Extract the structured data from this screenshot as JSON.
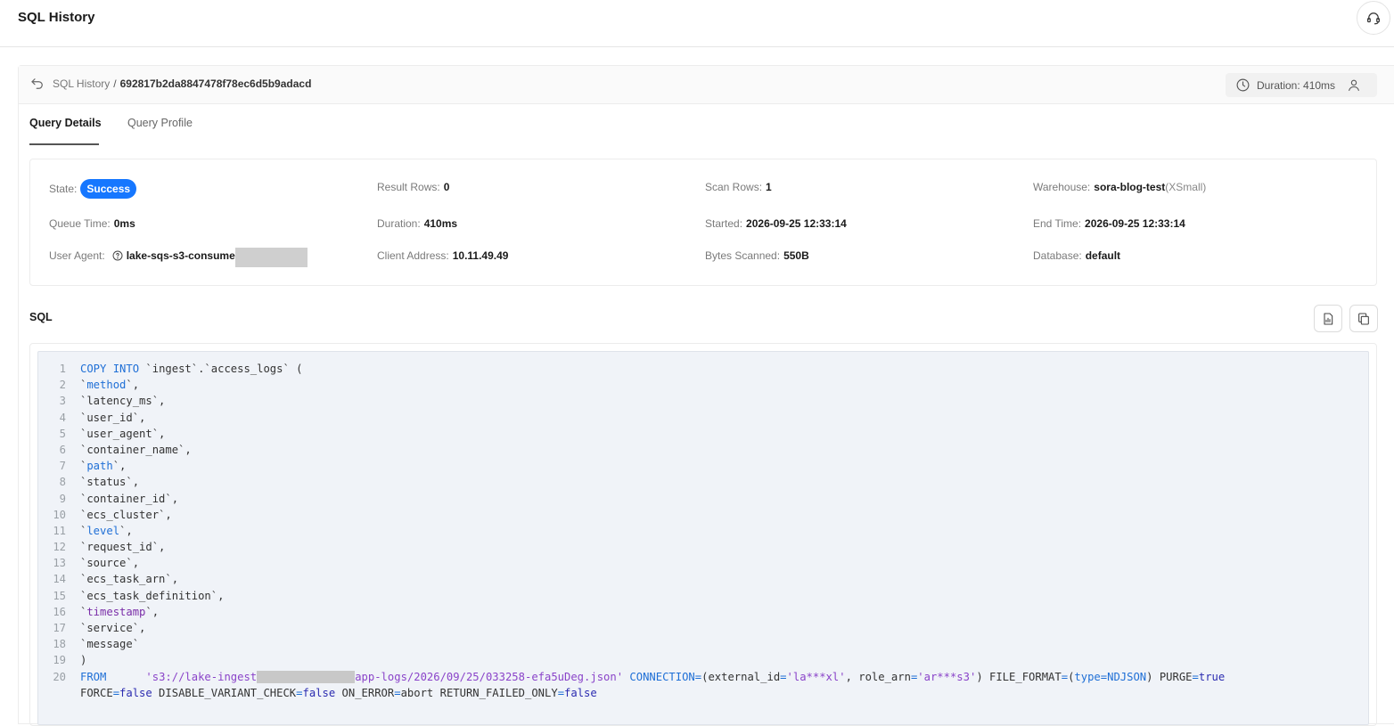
{
  "page": {
    "title": "SQL History"
  },
  "breadcrumb": {
    "parent": "SQL History",
    "separator": "/",
    "current": "692817b2da8847478f78ec6d5b9adacd"
  },
  "duration_pill": {
    "text": "Duration: 410ms"
  },
  "tabs": [
    {
      "label": "Query Details",
      "active": true
    },
    {
      "label": "Query Profile",
      "active": false
    }
  ],
  "details": {
    "state": {
      "label": "State",
      "value": "Success"
    },
    "result_rows": {
      "label": "Result Rows",
      "value": "0"
    },
    "scan_rows": {
      "label": "Scan Rows",
      "value": "1"
    },
    "warehouse": {
      "label": "Warehouse",
      "value": "sora-blog-test",
      "size": "(XSmall)"
    },
    "queue_time": {
      "label": "Queue Time",
      "value": "0ms"
    },
    "duration": {
      "label": "Duration",
      "value": "410ms"
    },
    "started": {
      "label": "Started",
      "value": "2026-09-25 12:33:14"
    },
    "end_time": {
      "label": "End Time",
      "value": "2026-09-25 12:33:14"
    },
    "user_agent": {
      "label": "User Agent",
      "value": "lake-sqs-s3-consume"
    },
    "client_address": {
      "label": "Client Address",
      "value": "10.11.49.49"
    },
    "bytes_scanned": {
      "label": "Bytes Scanned",
      "value": "550B"
    },
    "database": {
      "label": "Database",
      "value": "default"
    }
  },
  "sql": {
    "title": "SQL",
    "lines": [
      {
        "n": "1",
        "parts": [
          [
            "kw",
            "COPY"
          ],
          [
            "t",
            " "
          ],
          [
            "kw",
            "INTO"
          ],
          [
            "t",
            " `ingest`.`access_logs` ("
          ]
        ]
      },
      {
        "n": "2",
        "parts": [
          [
            "t",
            "`"
          ],
          [
            "kw",
            "method"
          ],
          [
            "t",
            "`,"
          ]
        ]
      },
      {
        "n": "3",
        "parts": [
          [
            "t",
            "`latency_ms`,"
          ]
        ]
      },
      {
        "n": "4",
        "parts": [
          [
            "t",
            "`user_id`,"
          ]
        ]
      },
      {
        "n": "5",
        "parts": [
          [
            "t",
            "`user_agent`,"
          ]
        ]
      },
      {
        "n": "6",
        "parts": [
          [
            "t",
            "`container_name`,"
          ]
        ]
      },
      {
        "n": "7",
        "parts": [
          [
            "t",
            "`"
          ],
          [
            "kw",
            "path"
          ],
          [
            "t",
            "`,"
          ]
        ]
      },
      {
        "n": "8",
        "parts": [
          [
            "t",
            "`status`,"
          ]
        ]
      },
      {
        "n": "9",
        "parts": [
          [
            "t",
            "`container_id`,"
          ]
        ]
      },
      {
        "n": "10",
        "parts": [
          [
            "t",
            "`ecs_cluster`,"
          ]
        ]
      },
      {
        "n": "11",
        "parts": [
          [
            "t",
            "`"
          ],
          [
            "kw",
            "level"
          ],
          [
            "t",
            "`,"
          ]
        ]
      },
      {
        "n": "12",
        "parts": [
          [
            "t",
            "`request_id`,"
          ]
        ]
      },
      {
        "n": "13",
        "parts": [
          [
            "t",
            "`source`,"
          ]
        ]
      },
      {
        "n": "14",
        "parts": [
          [
            "t",
            "`ecs_task_arn`,"
          ]
        ]
      },
      {
        "n": "15",
        "parts": [
          [
            "t",
            "`ecs_task_definition`,"
          ]
        ]
      },
      {
        "n": "16",
        "parts": [
          [
            "t",
            "`"
          ],
          [
            "kw2",
            "timestamp"
          ],
          [
            "t",
            "`,"
          ]
        ]
      },
      {
        "n": "17",
        "parts": [
          [
            "t",
            "`service`,"
          ]
        ]
      },
      {
        "n": "18",
        "parts": [
          [
            "t",
            "`message`"
          ]
        ]
      },
      {
        "n": "19",
        "parts": [
          [
            "t",
            ")"
          ]
        ]
      },
      {
        "n": "20",
        "parts": [
          [
            "kw",
            "FROM"
          ],
          [
            "t",
            "      "
          ],
          [
            "str",
            "'s3://lake-ingest"
          ],
          [
            "redact",
            "               "
          ],
          [
            "str",
            "app-logs/2026/09/25/033258-efa5uDeg.json'"
          ],
          [
            "t",
            " "
          ],
          [
            "kw",
            "CONNECTION"
          ],
          [
            "kw",
            "="
          ],
          [
            "t",
            "(external_id"
          ],
          [
            "kw",
            "="
          ],
          [
            "str",
            "'la***xl'"
          ],
          [
            "t",
            ", role_arn"
          ],
          [
            "kw",
            "="
          ],
          [
            "str",
            "'ar***s3'"
          ],
          [
            "t",
            ") FILE_FORMAT"
          ],
          [
            "kw",
            "="
          ],
          [
            "t",
            "("
          ],
          [
            "kw",
            "type"
          ],
          [
            "kw",
            "="
          ],
          [
            "kw",
            "NDJSON"
          ],
          [
            "t",
            ") PURGE"
          ],
          [
            "kw",
            "="
          ],
          [
            "lit",
            "true"
          ]
        ]
      },
      {
        "n": "",
        "parts": [
          [
            "t",
            "FORCE"
          ],
          [
            "kw",
            "="
          ],
          [
            "lit",
            "false"
          ],
          [
            "t",
            " DISABLE_VARIANT_CHECK"
          ],
          [
            "kw",
            "="
          ],
          [
            "lit",
            "false"
          ],
          [
            "t",
            " ON_ERROR"
          ],
          [
            "kw",
            "="
          ],
          [
            "t",
            "abort RETURN_FAILED_ONLY"
          ],
          [
            "kw",
            "="
          ],
          [
            "lit",
            "false"
          ]
        ]
      }
    ]
  },
  "icons": {
    "help": "headset-icon",
    "back": "undo-arrow-icon",
    "clock": "clock-icon",
    "user": "user-icon",
    "question": "question-circle-icon",
    "report": "report-icon",
    "copy": "copy-icon"
  },
  "colors": {
    "accent": "#1677ff",
    "keyword": "#1f6fd6",
    "string": "#8a43c9",
    "literal": "#2b2bb0"
  }
}
